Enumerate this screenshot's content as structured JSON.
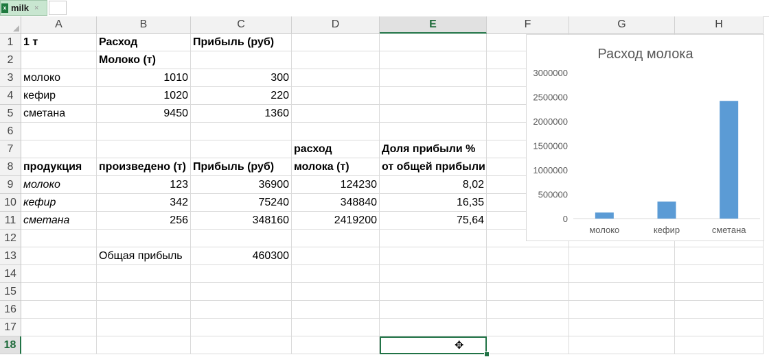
{
  "tab": {
    "icon": "excel-file-icon",
    "name": "milk",
    "close": "×"
  },
  "columns": [
    "A",
    "B",
    "C",
    "D",
    "E",
    "F",
    "G",
    "H"
  ],
  "active_column": "E",
  "active_row": "18",
  "rows": [
    "1",
    "2",
    "3",
    "4",
    "5",
    "6",
    "7",
    "8",
    "9",
    "10",
    "11",
    "12",
    "13",
    "14",
    "15",
    "16",
    "17",
    "18"
  ],
  "cells": {
    "A1": "1 т",
    "B1": "Расход",
    "C1": "Прибыль (руб)",
    "B2": "Молоко (т)",
    "A3": "молоко",
    "B3": "1010",
    "C3": "300",
    "A4": "кефир",
    "B4": "1020",
    "C4": "220",
    "A5": "сметана",
    "B5": "9450",
    "C5": "1360",
    "D7": "расход",
    "E7": "Доля прибыли %",
    "A8": "продукция",
    "B8": "произведено (т)",
    "C8": "Прибыль (руб)",
    "D8": "молока (т)",
    "E8": "от общей прибыли",
    "A9": "молоко",
    "B9": "123",
    "C9": "36900",
    "D9": "124230",
    "E9": "8,02",
    "A10": "кефир",
    "B10": "342",
    "C10": "75240",
    "D10": "348840",
    "E10": "16,35",
    "A11": "сметана",
    "B11": "256",
    "C11": "348160",
    "D11": "2419200",
    "E11": "75,64",
    "B13": "Общая прибыль",
    "C13": "460300"
  },
  "chart_data": {
    "type": "bar",
    "title": "Расход молока",
    "categories": [
      "молоко",
      "кефир",
      "сметана"
    ],
    "values": [
      124230,
      348840,
      2419200
    ],
    "ylim": [
      0,
      3000000
    ],
    "yticks": [
      "0",
      "500000",
      "1000000",
      "1500000",
      "2000000",
      "2500000",
      "3000000"
    ],
    "bar_color": "#5b9bd5",
    "grid": false
  }
}
